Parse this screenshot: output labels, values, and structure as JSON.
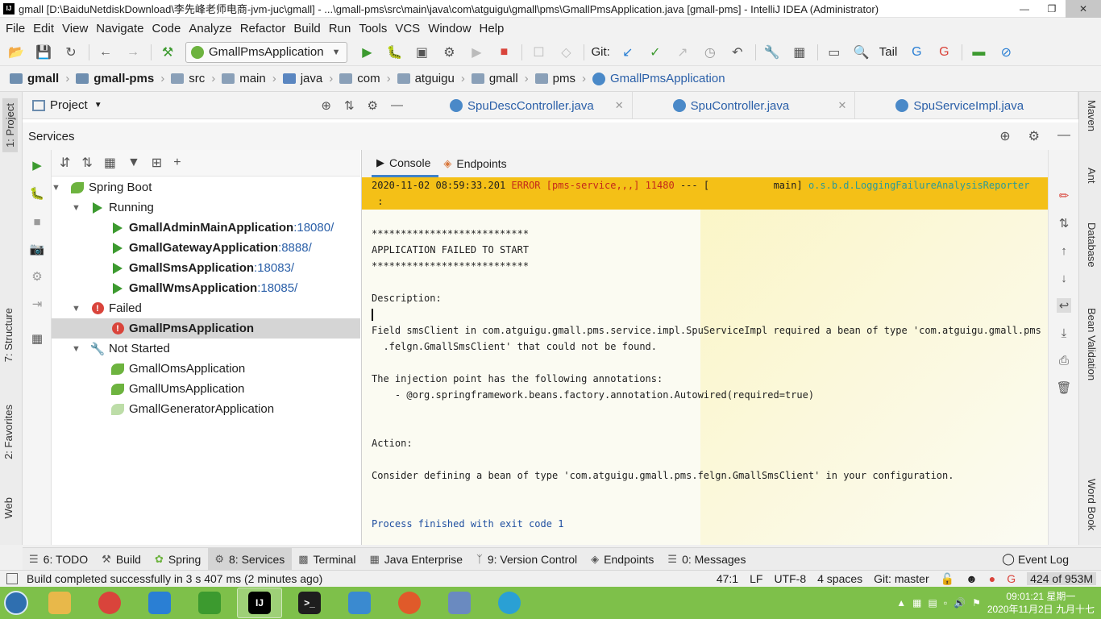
{
  "window": {
    "title": "gmall [D:\\BaiduNetdiskDownload\\李先峰老师电商-jvm-juc\\gmall] - ...\\gmall-pms\\src\\main\\java\\com\\atguigu\\gmall\\pms\\GmallPmsApplication.java [gmall-pms] - IntelliJ IDEA (Administrator)",
    "app_icon": "IJ"
  },
  "menu": [
    "File",
    "Edit",
    "View",
    "Navigate",
    "Code",
    "Analyze",
    "Refactor",
    "Build",
    "Run",
    "Tools",
    "VCS",
    "Window",
    "Help"
  ],
  "toolbar": {
    "run_config": "GmallPmsApplication",
    "git_label": "Git:",
    "tail_label": "Tail"
  },
  "breadcrumb": {
    "items": [
      "gmall",
      "gmall-pms",
      "src",
      "main",
      "java",
      "com",
      "atguigu",
      "gmall",
      "pms"
    ],
    "current": "GmallPmsApplication"
  },
  "left_strip": {
    "tabs": [
      "1: Project",
      "7: Structure",
      "2: Favorites",
      "Web"
    ]
  },
  "right_strip": {
    "tabs": [
      "Maven",
      "Ant",
      "Database",
      "Bean Validation",
      "Word Book"
    ]
  },
  "project_panel": {
    "label": "Project"
  },
  "editor_tabs": [
    {
      "label": "SpuDescController.java"
    },
    {
      "label": "SpuController.java"
    },
    {
      "label": "SpuServiceImpl.java"
    }
  ],
  "services": {
    "label": "Services",
    "tree": {
      "spring_boot": "Spring Boot",
      "running": "Running",
      "running_apps": [
        {
          "name": "GmallAdminMainApplication",
          "port": ":18080/"
        },
        {
          "name": "GmallGatewayApplication",
          "port": ":8888/"
        },
        {
          "name": "GmallSmsApplication",
          "port": ":18083/"
        },
        {
          "name": "GmallWmsApplication",
          "port": ":18085/"
        }
      ],
      "failed": "Failed",
      "failed_apps": [
        {
          "name": "GmallPmsApplication"
        }
      ],
      "not_started": "Not Started",
      "not_started_apps": [
        {
          "name": "GmallOmsApplication"
        },
        {
          "name": "GmallUmsApplication"
        },
        {
          "name": "GmallGeneratorApplication"
        }
      ]
    }
  },
  "console": {
    "tabs": [
      "Console",
      "Endpoints"
    ],
    "error_line": {
      "timestamp": "2020-11-02 08:59:33.201",
      "level": "ERROR",
      "service": "[pms-service,,,]",
      "pid": "11480",
      "sep": "---",
      "thread": "[           main]",
      "logger": "o.s.b.d.LoggingFailureAnalysisReporter",
      "tail": " :"
    },
    "stars": "***************************",
    "failed_title": "APPLICATION FAILED TO START",
    "description_label": "Description:",
    "description_line1": "Field smsClient in com.atguigu.gmall.pms.service.impl.SpuServiceImpl required a bean of type 'com.atguigu.gmall.pms",
    "description_line2": "  .felgn.GmallSmsClient' that could not be found.",
    "injection_label": "The injection point has the following annotations:",
    "injection_annotation": "    - @org.springframework.beans.factory.annotation.Autowired(required=true)",
    "action_label": "Action:",
    "action_text": "Consider defining a bean of type 'com.atguigu.gmall.pms.felgn.GmallSmsClient' in your configuration.",
    "exit_text": "Process finished with exit code 1"
  },
  "bottom_tabs": [
    {
      "label": "6: TODO",
      "icon": "list-icon"
    },
    {
      "label": "Build",
      "icon": "hammer-icon"
    },
    {
      "label": "Spring",
      "icon": "spring-icon"
    },
    {
      "label": "8: Services",
      "icon": "services-icon",
      "active": true
    },
    {
      "label": "Terminal",
      "icon": "terminal-icon"
    },
    {
      "label": "Java Enterprise",
      "icon": "java-ee-icon"
    },
    {
      "label": "9: Version Control",
      "icon": "vcs-icon"
    },
    {
      "label": "Endpoints",
      "icon": "endpoints-icon"
    },
    {
      "label": "0: Messages",
      "icon": "messages-icon"
    }
  ],
  "event_log": "Event Log",
  "status": {
    "message": "Build completed successfully in 3 s 407 ms (2 minutes ago)",
    "position": "47:1",
    "line_sep": "LF",
    "encoding": "UTF-8",
    "indent": "4 spaces",
    "git_branch": "Git: master",
    "memory": "424 of 953M"
  },
  "taskbar": {
    "time": "09:01:21 星期一",
    "date": "2020年11月2日 九月十七"
  },
  "colors": {
    "error_banner": "#f4c017",
    "error_red": "#c4281b",
    "link_blue": "#2a5fa8",
    "spring_green": "#6db33f",
    "taskbar_green": "#7ec04a"
  }
}
